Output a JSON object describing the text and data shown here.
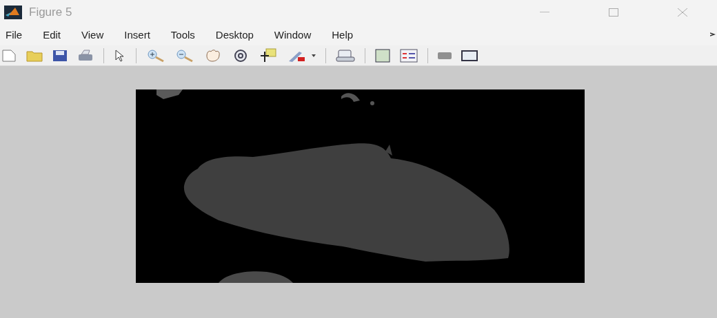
{
  "window": {
    "title": "Figure 5"
  },
  "menu": [
    "File",
    "Edit",
    "View",
    "Insert",
    "Tools",
    "Desktop",
    "Window",
    "Help"
  ]
}
